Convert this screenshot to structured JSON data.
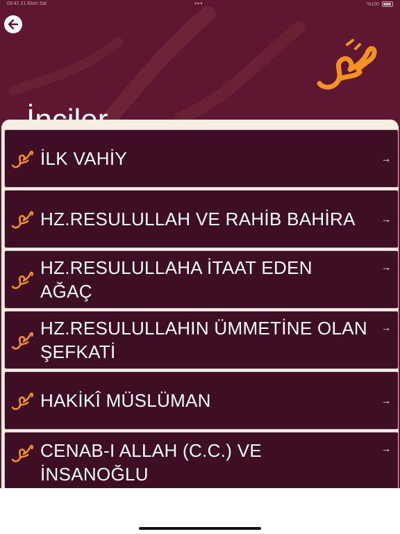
{
  "status_bar": {
    "left_text": "09:41  21 Ekim Sal",
    "center_text": "•••",
    "right_text": "%100"
  },
  "header": {
    "title": "İnciler"
  },
  "list": {
    "items": [
      {
        "label": "İLK VAHİY"
      },
      {
        "label": "HZ.RESULULLAH VE RAHİB BAHİRA"
      },
      {
        "label": "HZ.RESULULLAHA İTAAT EDEN AĞAÇ"
      },
      {
        "label": "HZ.RESULULLAHIN ÜMMETİNE OLAN ŞEFKATİ"
      },
      {
        "label": "HAKİKÎ MÜSLÜMAN"
      },
      {
        "label": "CENAB-I ALLAH (C.C.) VE İNSANOĞLU"
      }
    ],
    "arrow_glyph": "→"
  },
  "icons": {
    "back": "back-arrow-icon",
    "logo": "calligraphy-logo",
    "item_icon": "calligraphy-icon",
    "arrow": "arrow-right-icon"
  },
  "colors": {
    "background": "#5e1631",
    "item_background": "#3e0f24",
    "accent": "#f39322",
    "panel": "#f6eee3"
  }
}
